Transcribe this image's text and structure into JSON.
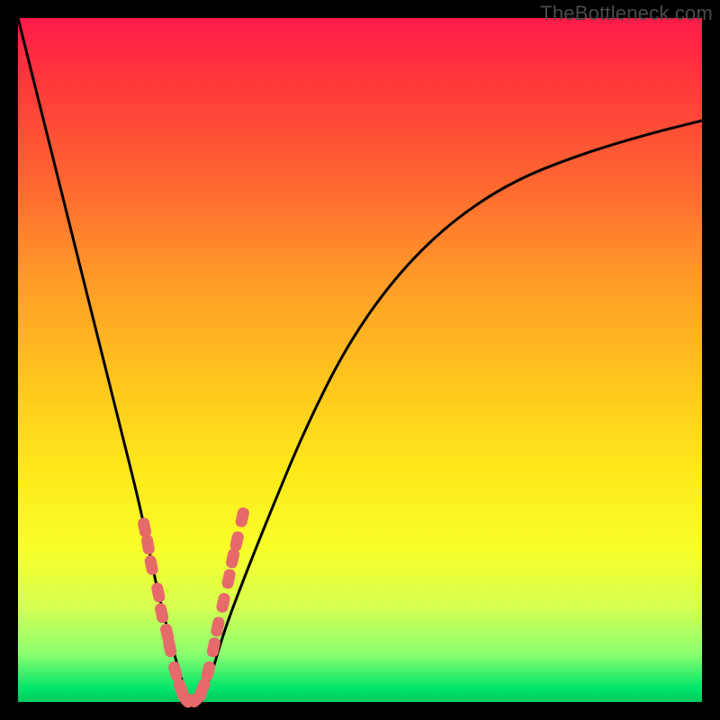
{
  "watermark": "TheBottleneck.com",
  "colors": {
    "frame": "#000000",
    "curve": "#000000",
    "marker_fill": "#e66a6a",
    "marker_stroke": "#c44d4d",
    "gradient_top": "#ff1a4a",
    "gradient_bottom": "#00c95e"
  },
  "chart_data": {
    "type": "line",
    "title": "",
    "xlabel": "",
    "ylabel": "",
    "xlim": [
      0,
      100
    ],
    "ylim": [
      0,
      100
    ],
    "grid": false,
    "legend": false,
    "series": [
      {
        "name": "bottleneck-curve",
        "x": [
          0,
          3,
          6,
          9,
          12,
          15,
          18,
          20,
          22,
          24,
          25,
          26,
          28,
          30,
          33,
          37,
          42,
          48,
          55,
          63,
          72,
          82,
          92,
          100
        ],
        "y": [
          100,
          88,
          76,
          64,
          52,
          40,
          28,
          18,
          10,
          3,
          0,
          0,
          3,
          10,
          18,
          28,
          40,
          52,
          62,
          70,
          76,
          80,
          83,
          85
        ]
      }
    ],
    "markers": {
      "name": "highlighted-points",
      "x": [
        18.5,
        19.0,
        19.5,
        20.5,
        21.0,
        21.8,
        22.2,
        23.0,
        23.8,
        24.5,
        25.2,
        26.2,
        27.0,
        27.8,
        28.6,
        29.2,
        30.0,
        30.8,
        31.4,
        32.0,
        32.8
      ],
      "y": [
        25.5,
        23.0,
        20.0,
        16.0,
        13.0,
        10.0,
        8.0,
        4.5,
        2.0,
        0.5,
        0.3,
        0.5,
        2.0,
        4.5,
        8.0,
        11.0,
        14.5,
        18.0,
        21.0,
        23.5,
        27.0
      ]
    }
  }
}
